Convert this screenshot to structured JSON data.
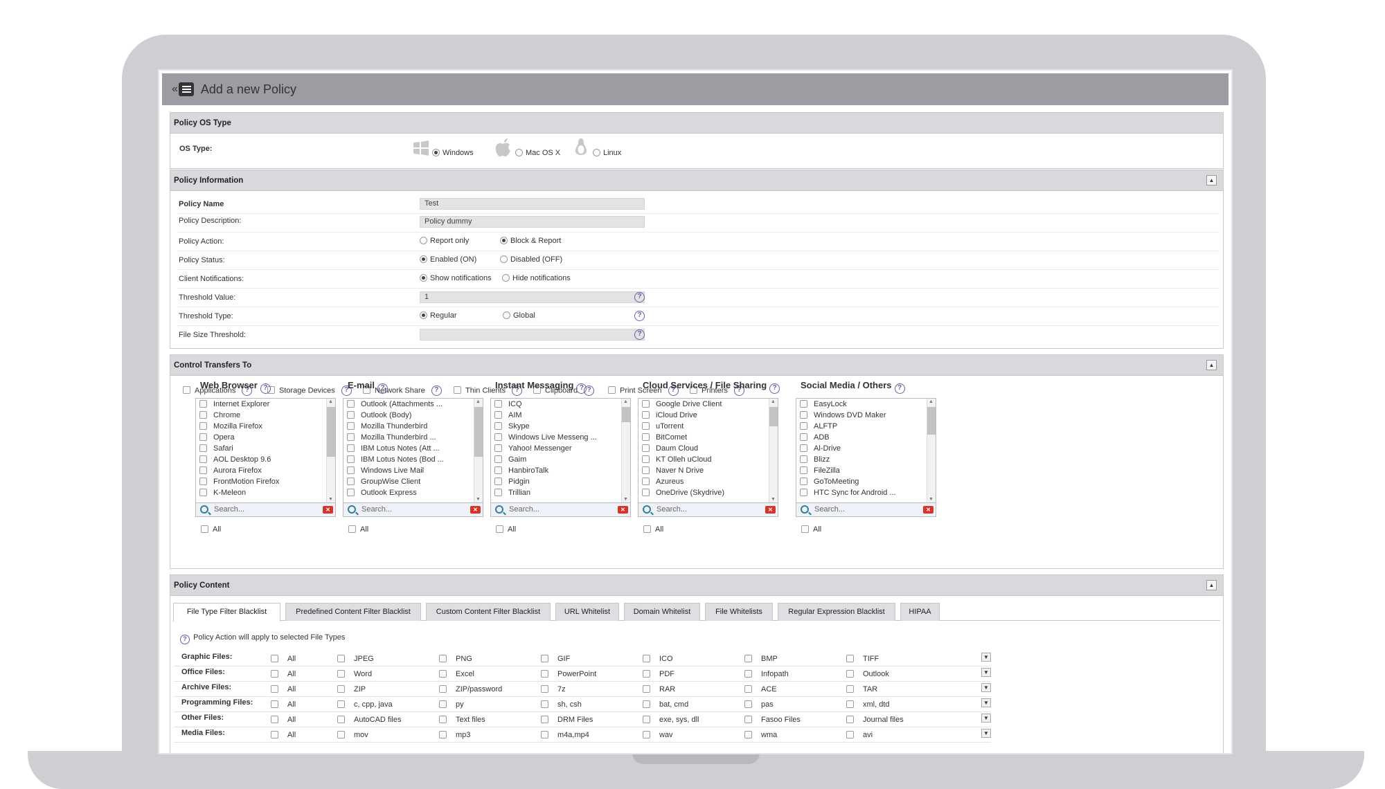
{
  "window": {
    "title": "Add a new Policy"
  },
  "os_section": {
    "header": "Policy OS Type",
    "label": "OS Type:",
    "options": [
      {
        "label": "Windows",
        "icon": "windows-icon",
        "selected": true
      },
      {
        "label": "Mac OS X",
        "icon": "apple-icon",
        "selected": false
      },
      {
        "label": "Linux",
        "icon": "linux-icon",
        "selected": false
      }
    ]
  },
  "policy_info": {
    "header": "Policy Information",
    "name_label": "Policy Name",
    "name_value": "Test",
    "description_label": "Policy Description:",
    "description_value": "Policy dummy",
    "action_label": "Policy Action:",
    "action_options": [
      "Report only",
      "Block & Report"
    ],
    "action_selected": "Block & Report",
    "status_label": "Policy Status:",
    "status_options": [
      "Enabled (ON)",
      "Disabled (OFF)"
    ],
    "status_selected": "Enabled (ON)",
    "notif_label": "Client Notifications:",
    "notif_options": [
      "Show notifications",
      "Hide notifications"
    ],
    "notif_selected": "Show notifications",
    "threshold_label": "Threshold Value:",
    "threshold_value": "1",
    "threshold_type_label": "Threshold Type:",
    "threshold_type_options": [
      "Regular",
      "Global"
    ],
    "threshold_type_selected": "Regular",
    "filesize_label": "File Size Threshold:",
    "filesize_value": ""
  },
  "control_transfers": {
    "header": "Control Transfers To",
    "targets": [
      "Applications",
      "Storage Devices",
      "Network Share",
      "Thin Clients",
      "Clipboard",
      "Print Screen",
      "Printers"
    ],
    "search_placeholder": "Search...",
    "all_label": "All",
    "lists": [
      {
        "title": "Web Browser",
        "items": [
          "Internet Explorer",
          "Chrome",
          "Mozilla Firefox",
          "Opera",
          "Safari",
          "AOL Desktop 9.6",
          "Aurora Firefox",
          "FrontMotion Firefox",
          "K-Meleon"
        ]
      },
      {
        "title": "E-mail",
        "items": [
          "Outlook (Attachments ...",
          "Outlook (Body)",
          "Mozilla Thunderbird",
          "Mozilla Thunderbird ...",
          "IBM Lotus Notes (Att ...",
          "IBM Lotus Notes (Bod ...",
          "Windows Live Mail",
          "GroupWise Client",
          "Outlook Express"
        ]
      },
      {
        "title": "Instant Messaging",
        "items": [
          "ICQ",
          "AIM",
          "Skype",
          "Windows Live Messeng ...",
          "Yahoo! Messenger",
          "Gaim",
          "HanbiroTalk",
          "Pidgin",
          "Trillian"
        ]
      },
      {
        "title": "Cloud Services / File Sharing",
        "items": [
          "Google Drive Client",
          "iCloud Drive",
          "uTorrent",
          "BitComet",
          "Daum Cloud",
          "KT Olleh uCloud",
          "Naver N Drive",
          "Azureus",
          "OneDrive (Skydrive)"
        ]
      },
      {
        "title": "Social Media / Others",
        "items": [
          "EasyLock",
          "Windows DVD Maker",
          "ALFTP",
          "ADB",
          "Al-Drive",
          "Blizz",
          "FileZilla",
          "GoToMeeting",
          "HTC Sync for Android ..."
        ]
      }
    ]
  },
  "policy_content": {
    "header": "Policy Content",
    "tabs": [
      "File Type Filter Blacklist",
      "Predefined Content Filter Blacklist",
      "Custom Content Filter Blacklist",
      "URL Whitelist",
      "Domain Whitelist",
      "File Whitelists",
      "Regular Expression Blacklist",
      "HIPAA"
    ],
    "active_tab": "File Type Filter Blacklist",
    "note": "Policy Action will apply to selected File Types",
    "file_groups": [
      {
        "label": "Graphic Files:",
        "options": [
          "All",
          "JPEG",
          "PNG",
          "GIF",
          "ICO",
          "BMP",
          "TIFF"
        ]
      },
      {
        "label": "Office Files:",
        "options": [
          "All",
          "Word",
          "Excel",
          "PowerPoint",
          "PDF",
          "Infopath",
          "Outlook"
        ]
      },
      {
        "label": "Archive Files:",
        "options": [
          "All",
          "ZIP",
          "ZIP/password",
          "7z",
          "RAR",
          "ACE",
          "TAR"
        ]
      },
      {
        "label": "Programming Files:",
        "options": [
          "All",
          "c, cpp, java",
          "py",
          "sh, csh",
          "bat, cmd",
          "pas",
          "xml, dtd"
        ]
      },
      {
        "label": "Other Files:",
        "options": [
          "All",
          "AutoCAD files",
          "Text files",
          "DRM Files",
          "exe, sys, dll",
          "Fasoo Files",
          "Journal files"
        ]
      },
      {
        "label": "Media Files:",
        "options": [
          "All",
          "mov",
          "mp3",
          "m4a,mp4",
          "wav",
          "wma",
          "avi"
        ]
      }
    ]
  }
}
